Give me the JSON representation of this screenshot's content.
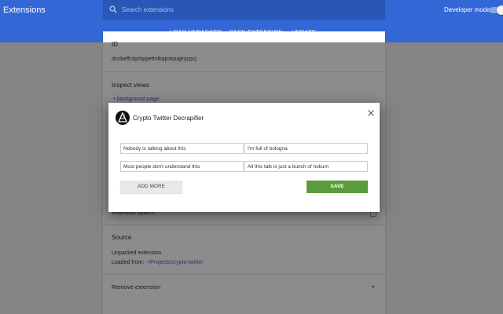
{
  "header": {
    "title": "Extensions",
    "search_placeholder": "Search extensions",
    "developer_mode_label": "Developer mode",
    "developer_mode_on": true
  },
  "toolbar": {
    "load_unpacked": "LOAD UNPACKED",
    "pack_extension": "PACK EXTENSION",
    "update": "UPDATE"
  },
  "card": {
    "id_label": "ID",
    "id_value": "dncbeffcbjchppefmlkajmkpajmjcpcj",
    "inspect_label": "Inspect views",
    "inspect_link": "background page",
    "options_label": "Extension options",
    "source_label": "Source",
    "source_type": "Unpacked extension",
    "loaded_from_label": "Loaded from:",
    "loaded_from_path": "~/Projects/crypto-twitter",
    "remove_label": "Remove extension"
  },
  "dialog": {
    "title": "Crypto Twitter Decrapifier",
    "fields": [
      "Nobody is talking about this",
      "I'm full of bologna",
      "Most people don't understand this",
      "All this talk is just a bunch of hokum"
    ],
    "add_more_label": "ADD MORE",
    "save_label": "SAVE",
    "accent_color": "#5a9c3b"
  },
  "colors": {
    "header_bg": "#3367d6",
    "link": "#3367d6"
  }
}
